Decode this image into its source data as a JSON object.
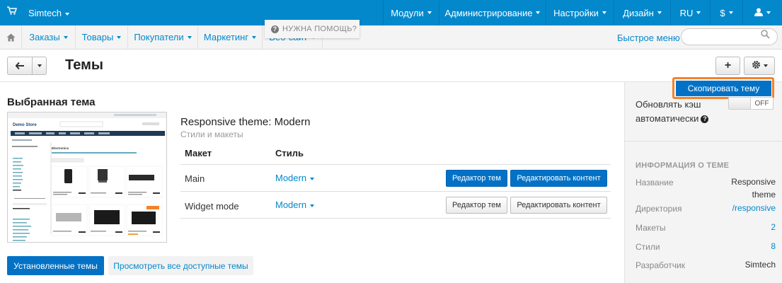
{
  "topbar": {
    "brand": "Simtech",
    "menus": [
      "Модули",
      "Администрирование",
      "Настройки",
      "Дизайн",
      "RU",
      "$"
    ],
    "user_icon": "user-icon",
    "cart_icon": "cart-icon"
  },
  "subbar": {
    "home_icon": "home-icon",
    "nav": [
      "Заказы",
      "Товары",
      "Покупатели",
      "Маркетинг",
      "Веб-сайт"
    ],
    "quick_menu": "Быстрое меню",
    "search_placeholder": ""
  },
  "toolbar": {
    "title": "Темы",
    "help": "НУЖНА ПОМОЩЬ?",
    "add_icon": "plus-icon",
    "settings_icon": "gear-icon"
  },
  "sidebar": {
    "copy_button": "Скопировать тему",
    "cache_label": "Обновлять кэш автоматически",
    "cache_toggle": "OFF",
    "info_heading": "ИНФОРМАЦИЯ О ТЕМЕ",
    "info": [
      {
        "key": "Название",
        "value": "Responsive theme"
      },
      {
        "key": "Директория",
        "value": "/responsive"
      },
      {
        "key": "Макеты",
        "value": "2"
      },
      {
        "key": "Стили",
        "value": "8"
      },
      {
        "key": "Разработчик",
        "value": "Simtech"
      }
    ]
  },
  "main": {
    "section_title": "Выбранная тема",
    "theme_name": "Responsive theme: Modern",
    "theme_sub": "Стили и макеты",
    "table_headers": [
      "Макет",
      "Стиль"
    ],
    "rows": [
      {
        "layout": "Main",
        "style": "Modern",
        "btn_editor": "Редактор тем",
        "btn_content": "Редактировать контент",
        "active": true
      },
      {
        "layout": "Widget mode",
        "style": "Modern",
        "btn_editor": "Редактор тем",
        "btn_content": "Редактировать контент",
        "active": false
      }
    ],
    "btn_installed": "Установленные темы",
    "btn_all": "Просмотреть все доступные темы"
  },
  "preview": {
    "logo": "Demo Store",
    "category": "Electronics"
  },
  "colors": {
    "topbar": "#0388cc",
    "primary_button": "#0372c6",
    "highlight": "#f5822a"
  }
}
